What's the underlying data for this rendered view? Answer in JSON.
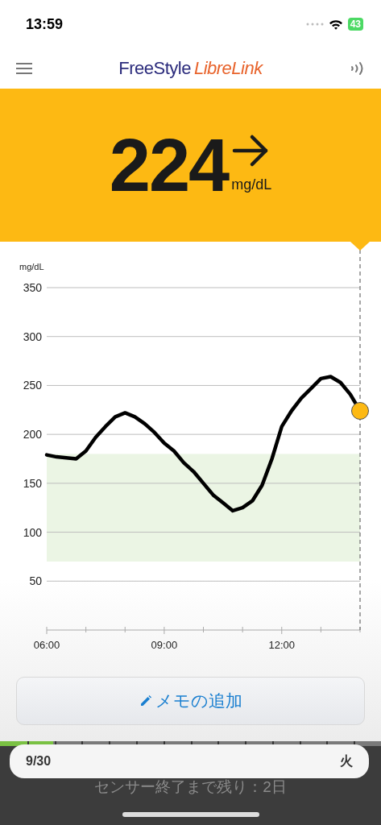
{
  "status_bar": {
    "time": "13:59",
    "battery": "43"
  },
  "nav": {
    "brand_first": "FreeStyle",
    "brand_second": "LibreLink"
  },
  "reading": {
    "value": "224",
    "unit": "mg/dL"
  },
  "chart": {
    "chart_data": {
      "type": "line",
      "ylabel": "mg/dL",
      "x": [
        6,
        6.25,
        6.5,
        6.75,
        7,
        7.25,
        7.5,
        7.75,
        8,
        8.25,
        8.5,
        8.75,
        9,
        9.25,
        9.5,
        9.75,
        10,
        10.25,
        10.5,
        10.75,
        11,
        11.25,
        11.5,
        11.75,
        12,
        12.25,
        12.5,
        12.75,
        13,
        13.25,
        13.5,
        13.75,
        14
      ],
      "series": [
        {
          "color": "#000000",
          "values": [
            179,
            177,
            176,
            175,
            183,
            197,
            208,
            218,
            222,
            218,
            211,
            202,
            191,
            183,
            171,
            162,
            150,
            138,
            130,
            122,
            125,
            132,
            148,
            175,
            208,
            224,
            237,
            247,
            257,
            259,
            253,
            241,
            224
          ]
        }
      ],
      "xlim": [
        6,
        14
      ],
      "ylim": [
        0,
        350
      ],
      "xticks": [
        {
          "value": 6,
          "label": "06:00"
        },
        {
          "value": 9,
          "label": "09:00"
        },
        {
          "value": 12,
          "label": "12:00"
        }
      ],
      "yticks": [
        50,
        100,
        150,
        200,
        250,
        300,
        350
      ],
      "grid": true,
      "bands": [
        {
          "axis": "y",
          "from": 70,
          "to": 180,
          "color": "#ebf5e4"
        }
      ]
    }
  },
  "memo_button": {
    "label": "メモの追加"
  },
  "sensor": {
    "level": 0.14,
    "date": "9/30",
    "weekday": "火",
    "remaining": "センサー終了まで残り：2日"
  }
}
